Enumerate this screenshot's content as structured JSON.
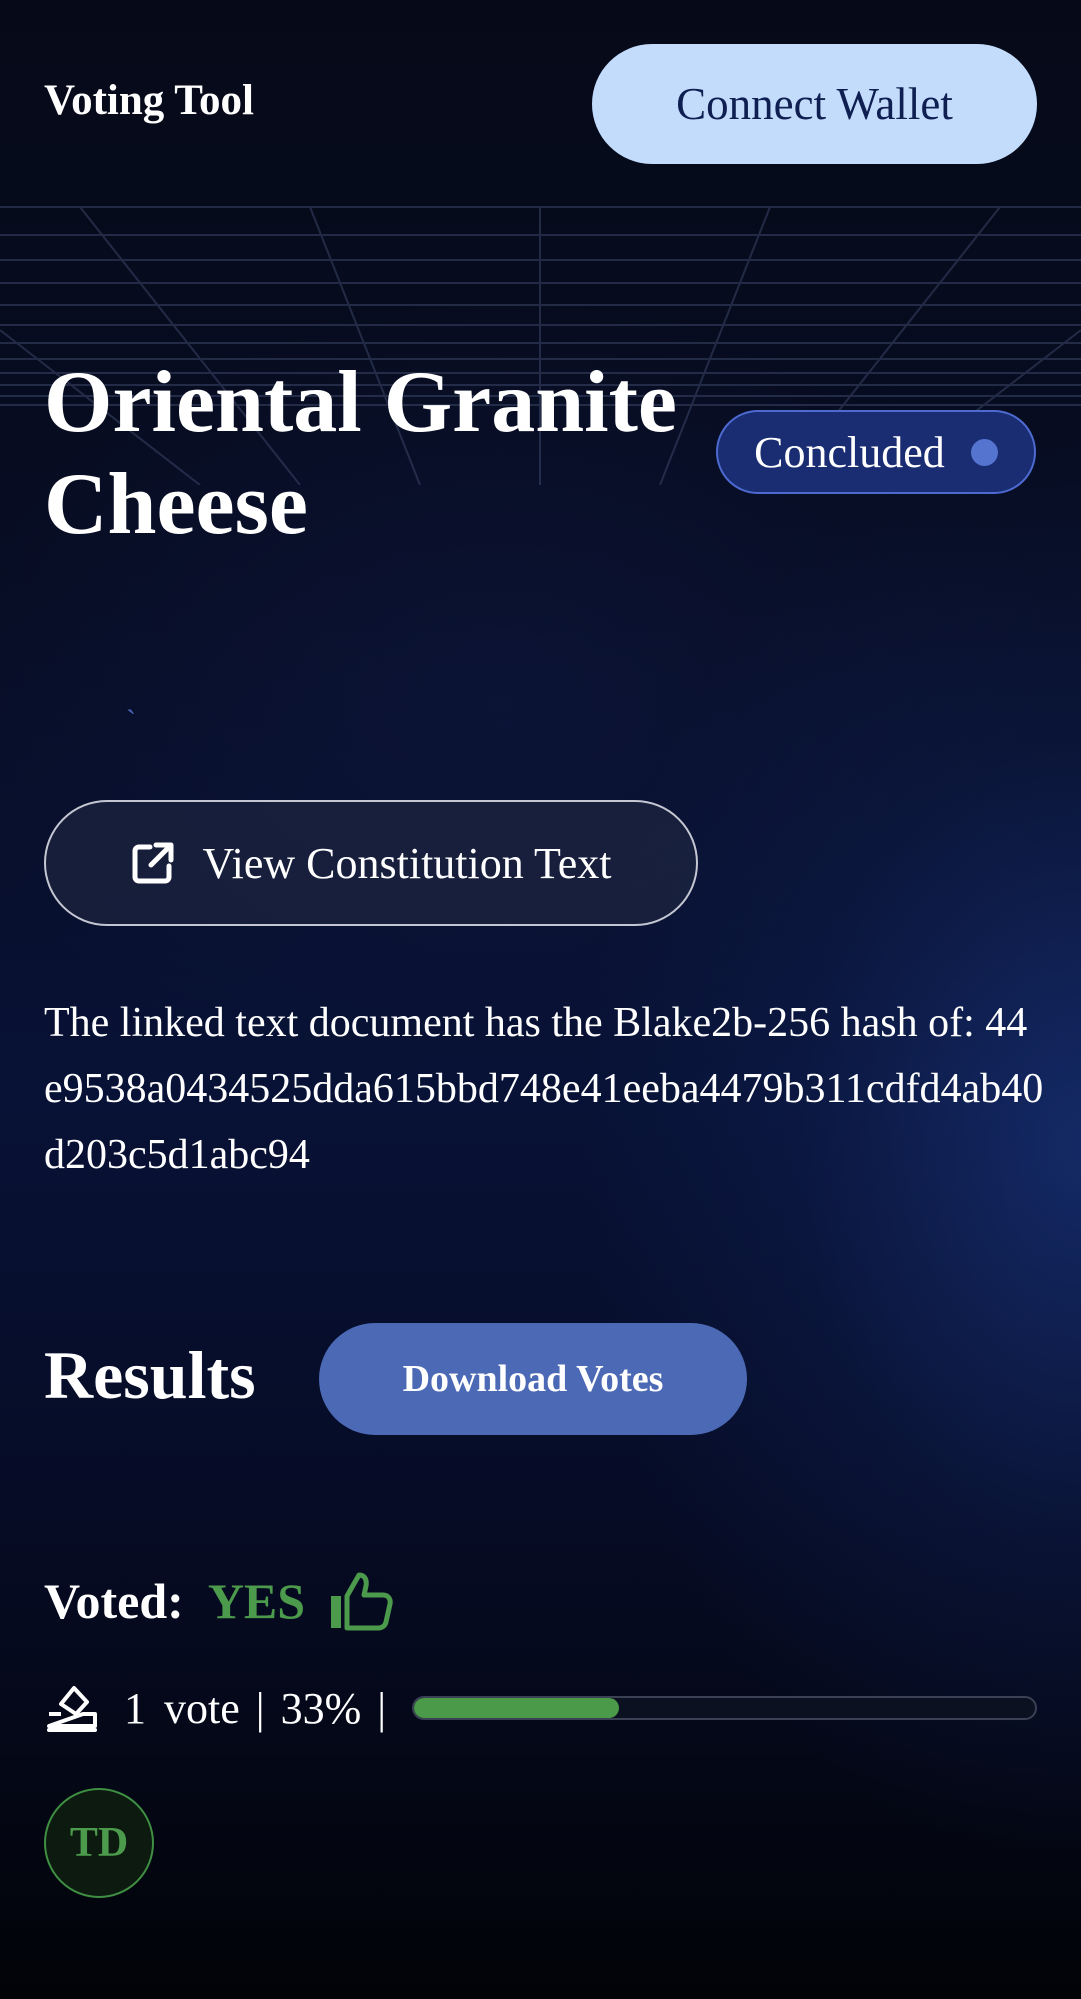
{
  "header": {
    "title": "Voting Tool",
    "connect_label": "Connect Wallet"
  },
  "proposal": {
    "title": "Oriental Granite Cheese",
    "status": "Concluded",
    "stray_mark": "`",
    "view_button_label": "View Constitution Text",
    "view_button_icon": "external-link-icon",
    "hash_text": "The linked text document has the Blake2b-256 hash of: 44e9538a0434525dda615bbd748e41eeba4479b311cdfd4ab40d203c5d1abc94"
  },
  "results": {
    "heading": "Results",
    "download_label": "Download Votes",
    "voted_label": "Voted:",
    "voted_value": "YES",
    "voted_icon": "thumbs-up-icon",
    "ballot_icon": "ballot-box-icon",
    "vote_count": "1",
    "vote_word": "vote",
    "separator": "|",
    "percent_text": "33%",
    "percent": 33,
    "voter_initials": "TD"
  },
  "colors": {
    "accent": "#4c69b5",
    "wallet_button": "#c3dcfb",
    "yes_green": "#4c9a4b",
    "status_dot": "#5474cf"
  }
}
